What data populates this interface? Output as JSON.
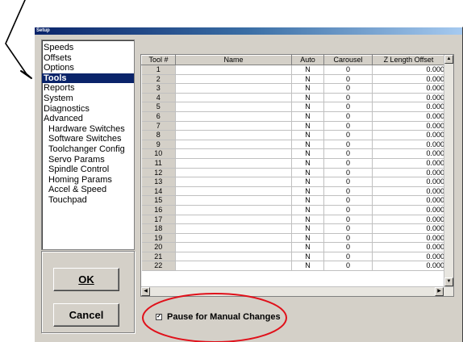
{
  "window": {
    "title": "Setup"
  },
  "nav": {
    "items": [
      {
        "label": "Speeds",
        "sub": false,
        "selected": false
      },
      {
        "label": "Offsets",
        "sub": false,
        "selected": false
      },
      {
        "label": "Options",
        "sub": false,
        "selected": false
      },
      {
        "label": "Tools",
        "sub": false,
        "selected": true
      },
      {
        "label": "Reports",
        "sub": false,
        "selected": false
      },
      {
        "label": "System",
        "sub": false,
        "selected": false
      },
      {
        "label": "Diagnostics",
        "sub": false,
        "selected": false
      },
      {
        "label": "Advanced",
        "sub": false,
        "selected": false
      },
      {
        "label": "Hardware Switches",
        "sub": true,
        "selected": false
      },
      {
        "label": "Software Switches",
        "sub": true,
        "selected": false
      },
      {
        "label": "Toolchanger Config",
        "sub": true,
        "selected": false
      },
      {
        "label": "Servo Params",
        "sub": true,
        "selected": false
      },
      {
        "label": "Spindle Control",
        "sub": true,
        "selected": false
      },
      {
        "label": "Homing Params",
        "sub": true,
        "selected": false
      },
      {
        "label": "Accel & Speed",
        "sub": true,
        "selected": false
      },
      {
        "label": "Touchpad",
        "sub": true,
        "selected": false
      }
    ]
  },
  "buttons": {
    "ok": "OK",
    "cancel": "Cancel"
  },
  "table": {
    "columns": [
      "Tool #",
      "Name",
      "Auto",
      "Carousel",
      "Z Length Offset"
    ],
    "rows": [
      [
        "1",
        "",
        "N",
        "0",
        "0.000"
      ],
      [
        "2",
        "",
        "N",
        "0",
        "0.000"
      ],
      [
        "3",
        "",
        "N",
        "0",
        "0.000"
      ],
      [
        "4",
        "",
        "N",
        "0",
        "0.000"
      ],
      [
        "5",
        "",
        "N",
        "0",
        "0.000"
      ],
      [
        "6",
        "",
        "N",
        "0",
        "0.000"
      ],
      [
        "7",
        "",
        "N",
        "0",
        "0.000"
      ],
      [
        "8",
        "",
        "N",
        "0",
        "0.000"
      ],
      [
        "9",
        "",
        "N",
        "0",
        "0.000"
      ],
      [
        "10",
        "",
        "N",
        "0",
        "0.000"
      ],
      [
        "11",
        "",
        "N",
        "0",
        "0.000"
      ],
      [
        "12",
        "",
        "N",
        "0",
        "0.000"
      ],
      [
        "13",
        "",
        "N",
        "0",
        "0.000"
      ],
      [
        "14",
        "",
        "N",
        "0",
        "0.000"
      ],
      [
        "15",
        "",
        "N",
        "0",
        "0.000"
      ],
      [
        "16",
        "",
        "N",
        "0",
        "0.000"
      ],
      [
        "17",
        "",
        "N",
        "0",
        "0.000"
      ],
      [
        "18",
        "",
        "N",
        "0",
        "0.000"
      ],
      [
        "19",
        "",
        "N",
        "0",
        "0.000"
      ],
      [
        "20",
        "",
        "N",
        "0",
        "0.000"
      ],
      [
        "21",
        "",
        "N",
        "0",
        "0.000"
      ],
      [
        "22",
        "",
        "N",
        "0",
        "0.000"
      ]
    ]
  },
  "pause": {
    "label": "Pause for Manual Changes",
    "checked": true,
    "check_glyph": "✓"
  },
  "annotation": {
    "color": "#e0101a"
  }
}
